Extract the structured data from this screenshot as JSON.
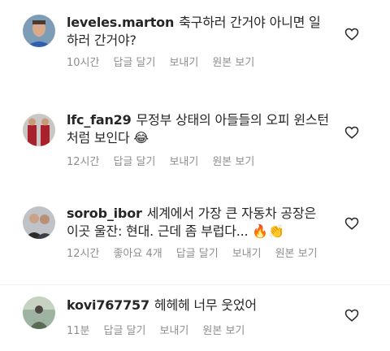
{
  "comments": [
    {
      "username": "leveles.marton",
      "text": "축구하러 간거야 아니면 일하러 간거야?",
      "time": "10시간",
      "likes": "",
      "reply": "답글 달기",
      "send": "보내기",
      "original": "원본 보기"
    },
    {
      "username": "lfc_fan29",
      "text": "무정부 상태의 아들들의 오피 윈스턴처럼 보인다 😂",
      "time": "12시간",
      "likes": "",
      "reply": "답글 달기",
      "send": "보내기",
      "original": "원본 보기"
    },
    {
      "username": "sorob_ibor",
      "text": "세계에서 가장 큰 자동차 공장은 이곳 울잔: 현대. 근데 좀 부럽다... 🔥👏",
      "time": "12시간",
      "likes": "좋아요 4개",
      "reply": "답글 달기",
      "send": "보내기",
      "original": "원본 보기"
    },
    {
      "username": "kovi767757",
      "text": "헤헤헤 너무 웃었어",
      "time": "11분",
      "likes": "",
      "reply": "답글 달기",
      "send": "보내기",
      "original": "원본 보기"
    }
  ]
}
